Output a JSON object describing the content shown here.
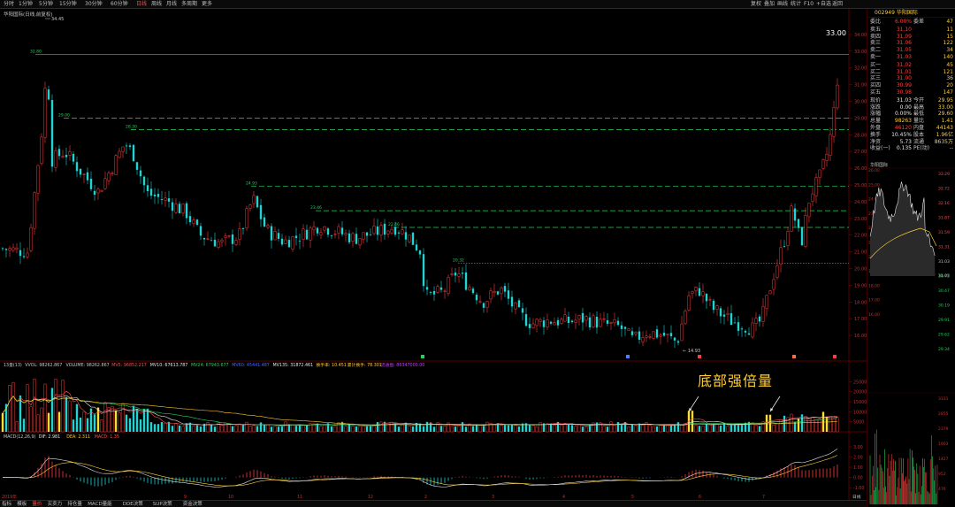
{
  "window": {
    "period_tabs": [
      "分时",
      "1分钟",
      "5分钟",
      "15分钟",
      "30分钟",
      "60分钟",
      "日线",
      "周线",
      "月线",
      "多周期",
      "更多"
    ],
    "active_period": "日线",
    "toolbar_right": [
      "复权",
      "叠加",
      "画线",
      "统计",
      "F10",
      "+自选",
      "返回"
    ]
  },
  "main_chart": {
    "title": "华阳国际(日线,前复权)",
    "high_marker": "34.45",
    "low_marker": "14.93",
    "last_price_label": "33.00",
    "price_levels": [
      {
        "price": "32.80",
        "color": "#22d35a",
        "style": "solid"
      },
      {
        "price": "29.00",
        "color": "#22d35a",
        "style": "dash"
      },
      {
        "price": "28.30",
        "color": "#22d35a",
        "style": "dash"
      },
      {
        "price": "24.93",
        "color": "#22d35a",
        "style": "dash"
      },
      {
        "price": "23.46",
        "color": "#22d35a",
        "style": "dash"
      },
      {
        "price": "22.46",
        "color": "#22d35a",
        "style": "dash"
      },
      {
        "price": "20.32",
        "color": "#22d35a",
        "style": "dot"
      }
    ],
    "y_axis_ticks": [
      "34.00",
      "33.00",
      "32.00",
      "31.00",
      "30.00",
      "29.00",
      "28.00",
      "27.00",
      "26.00",
      "25.00",
      "24.00",
      "23.00",
      "22.00",
      "21.00",
      "20.00",
      "19.00",
      "18.00",
      "17.00",
      "16.00"
    ],
    "y_axis_range": [
      15.0,
      35.0
    ]
  },
  "volume_panel": {
    "label_name": "13量(13)",
    "vvol": "VVOL: 98262.867",
    "volume": "VOLUME: 98262.867",
    "mv5": "MV5: 96852.217",
    "mv10": "MV10: 67613.787",
    "mv24": "MV24: 67943.677",
    "mv60": "MV60: 45441.487",
    "mv135": "MV135: 31872.461",
    "turnover": "换手率: 10.451",
    "cum_turnover": "累计换手: 78.301",
    "flow": "流通盘: 86347000.00",
    "y_ticks": [
      "25000",
      "20000",
      "15000",
      "10000",
      "5000"
    ],
    "y_max": 30000
  },
  "macd_panel": {
    "label": "MACD(12,26,9)",
    "dif": "DIF: 2.981",
    "dea": "DEA: 2.311",
    "macd": "MACD: 1.35",
    "y_ticks": [
      "3.00",
      "2.00",
      "1.00",
      "0.00",
      "-1.00"
    ],
    "y_range": [
      -2.2,
      3.6
    ]
  },
  "annotation": {
    "text": "底部强倍量",
    "arrow_targets_x": [
      778,
      870
    ]
  },
  "x_axis": {
    "labels": [
      "2019年",
      "9",
      "10",
      "11",
      "12",
      "2",
      "3",
      "4",
      "5",
      "6",
      "7"
    ],
    "corner": "日线"
  },
  "bottom_tabs": [
    "指标",
    "模板",
    "量价",
    "买卖力",
    "持仓量",
    "MACD量能",
    "DDE决策",
    "SUP决策",
    "资金决策"
  ],
  "active_bottom_tab": "量价",
  "quote_panel": {
    "code": "002949",
    "name": "华阳国际",
    "weibi": {
      "label": "委比",
      "value": "6.00%",
      "label2": "委差",
      "value2": "47"
    },
    "asks": [
      {
        "label": "卖五",
        "price": "31.10",
        "vol": "11"
      },
      {
        "label": "卖四",
        "price": "31.09",
        "vol": "15"
      },
      {
        "label": "卖三",
        "price": "31.06",
        "vol": "122"
      },
      {
        "label": "卖二",
        "price": "31.05",
        "vol": "34"
      },
      {
        "label": "卖一",
        "price": "31.03",
        "vol": "140"
      }
    ],
    "bids": [
      {
        "label": "买一",
        "price": "31.02",
        "vol": "45"
      },
      {
        "label": "买二",
        "price": "31.01",
        "vol": "121"
      },
      {
        "label": "买三",
        "price": "31.00",
        "vol": "36"
      },
      {
        "label": "买四",
        "price": "30.99",
        "vol": "20"
      },
      {
        "label": "买五",
        "price": "30.98",
        "vol": "147"
      }
    ],
    "stats": [
      {
        "l1": "现价",
        "v1": "31.03",
        "l2": "今开",
        "v2": "29.95"
      },
      {
        "l1": "涨跌",
        "v1": "0.00",
        "l2": "最高",
        "v2": "33.00"
      },
      {
        "l1": "涨幅",
        "v1": "0.00%",
        "l2": "最低",
        "v2": "29.60"
      },
      {
        "l1": "总量",
        "v1": "98263",
        "l2": "量比",
        "v2": "1.41"
      },
      {
        "l1": "外盘",
        "v1": "46120",
        "l2": "内盘",
        "v2": "44143"
      },
      {
        "l1": "换手",
        "v1": "10.45%",
        "l2": "股本",
        "v2": "1.96亿"
      },
      {
        "l1": "净资",
        "v1": "5.73",
        "l2": "流通",
        "v2": "8635万"
      },
      {
        "l1": "收益(一)",
        "v1": "0.135",
        "l2": "PE(动)",
        "v2": "--"
      }
    ],
    "mini_title": "华阳国际",
    "mini_left_ticks": [
      "26.00",
      "25.00",
      "24.00",
      "23.00",
      "22.00",
      "21.00",
      "20.00",
      "19.00",
      "18.00",
      "17.00",
      "16.00"
    ],
    "mini_price_ticks": [
      "33.29",
      "32.72",
      "32.16",
      "31.87",
      "31.59",
      "31.31",
      "31.03",
      "30.75",
      "30.47",
      "30.19",
      "29.91",
      "29.62",
      "29.34"
    ],
    "mini_vol_ticks": [
      "3331",
      "2855",
      "2379",
      "1903",
      "1427",
      "952",
      "476"
    ],
    "mini_current": "31.03"
  }
}
